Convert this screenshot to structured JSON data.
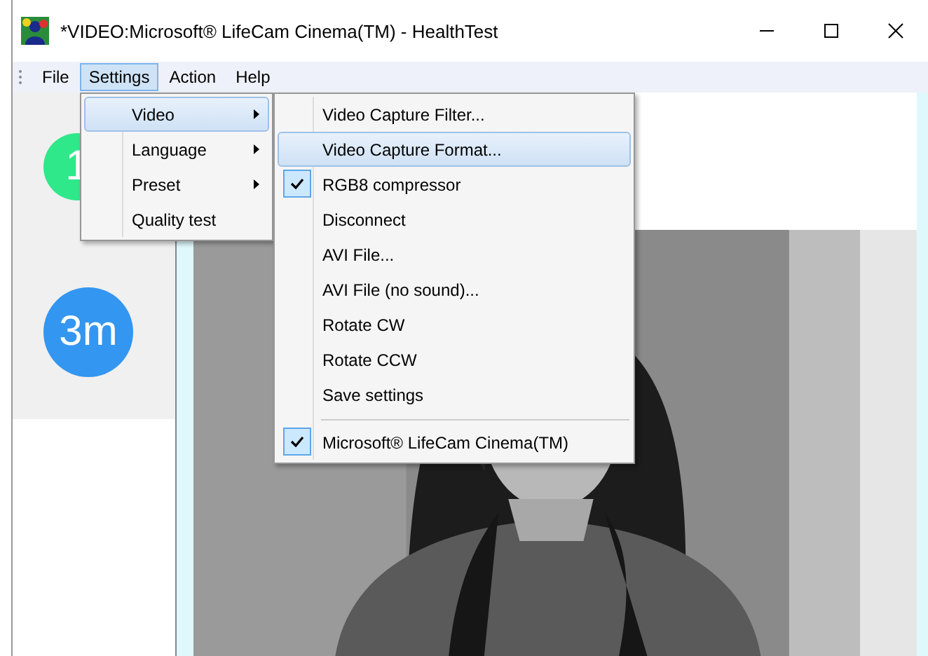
{
  "window": {
    "title": "*VIDEO:Microsoft® LifeCam Cinema(TM) - HealthTest"
  },
  "menu_bar": [
    {
      "label": "File",
      "selected": false
    },
    {
      "label": "Settings",
      "selected": true
    },
    {
      "label": "Action",
      "selected": false
    },
    {
      "label": "Help",
      "selected": false
    }
  ],
  "sidebar": {
    "badges": [
      {
        "text": "1",
        "color": "#2ee88a"
      },
      {
        "text": "3m",
        "color": "#3396f0"
      }
    ]
  },
  "settings_menu": {
    "items": [
      {
        "label": "Video",
        "submenu": true,
        "selected": true
      },
      {
        "label": "Language",
        "submenu": true,
        "selected": false
      },
      {
        "label": "Preset",
        "submenu": true,
        "selected": false
      },
      {
        "label": "Quality test",
        "submenu": false,
        "selected": false
      }
    ]
  },
  "video_submenu": {
    "items": [
      {
        "label": "Video Capture Filter...",
        "checked": false,
        "selected": false,
        "separator_before": false
      },
      {
        "label": "Video Capture Format...",
        "checked": false,
        "selected": true,
        "separator_before": false
      },
      {
        "label": "RGB8 compressor",
        "checked": true,
        "selected": false,
        "separator_before": false
      },
      {
        "label": "Disconnect",
        "checked": false,
        "selected": false,
        "separator_before": false
      },
      {
        "label": "AVI File...",
        "checked": false,
        "selected": false,
        "separator_before": false
      },
      {
        "label": "AVI File (no sound)...",
        "checked": false,
        "selected": false,
        "separator_before": false
      },
      {
        "label": "Rotate CW",
        "checked": false,
        "selected": false,
        "separator_before": false
      },
      {
        "label": "Rotate CCW",
        "checked": false,
        "selected": false,
        "separator_before": false
      },
      {
        "label": "Save settings",
        "checked": false,
        "selected": false,
        "separator_before": false
      },
      {
        "label": "Microsoft® LifeCam Cinema(TM)",
        "checked": true,
        "selected": false,
        "separator_before": true
      }
    ]
  }
}
